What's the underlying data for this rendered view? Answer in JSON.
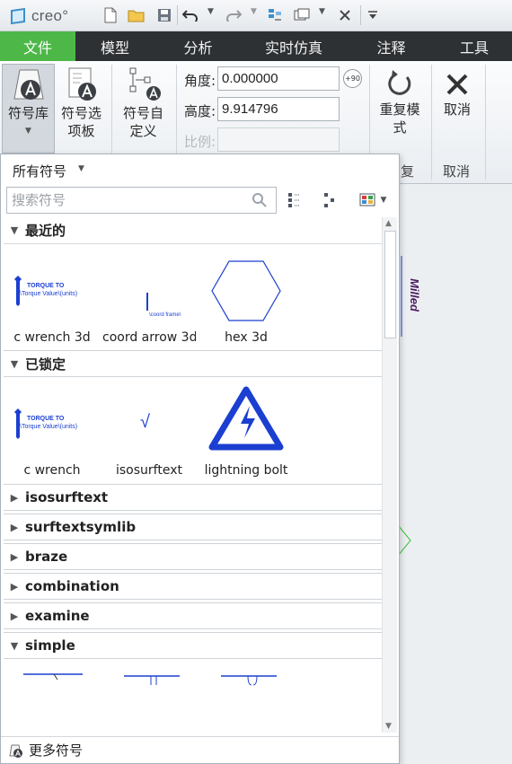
{
  "app": {
    "logo_text": "creo°"
  },
  "quick_access": {
    "icons": [
      "new-file-icon",
      "open-folder-icon",
      "save-icon",
      "undo-icon",
      "redo-icon",
      "regenerate-icon",
      "window-icon",
      "close-window-icon",
      "customize-icon"
    ]
  },
  "tabs": [
    {
      "label": "文件",
      "active": true
    },
    {
      "label": "模型"
    },
    {
      "label": "分析"
    },
    {
      "label": "实时仿真"
    },
    {
      "label": "注释"
    },
    {
      "label": "工具"
    }
  ],
  "ribbon": {
    "symbol_library": "符号库",
    "symbol_palette_l1": "符号选",
    "symbol_palette_l2": "项板",
    "custom_symbol_l1": "符号自",
    "custom_symbol_l2": "定义",
    "angle_label": "角度:",
    "angle_value": "0.000000",
    "height_label": "高度:",
    "height_value": "9.914796",
    "scale_label": "比例:",
    "scale_value": "",
    "rotate_badge": "+90",
    "repeat_l1": "重复模",
    "repeat_l2": "式",
    "repeat_group": "复",
    "cancel_label": "取消",
    "cancel_group": "取消"
  },
  "palette": {
    "filter_label": "所有符号",
    "search_placeholder": "搜索符号",
    "sections": {
      "recent": {
        "label": "最近的",
        "items": [
          "c wrench 3d",
          "coord arrow 3d",
          "hex 3d"
        ]
      },
      "locked": {
        "label": "已锁定",
        "items": [
          "c wrench",
          "isosurftext",
          "lightning bolt"
        ]
      },
      "collapsed": [
        "isosurftext",
        "surftextsymlib",
        "braze",
        "combination",
        "examine"
      ],
      "simple": {
        "label": "simple"
      }
    },
    "more_symbols": "更多符号",
    "torque_line1": "TORQUE TO",
    "torque_line2": "\\Torque Value\\(units)",
    "coord_text": "\\coord frame\\",
    "checkmark": "√"
  },
  "canvas": {
    "milled_text": "Milled"
  },
  "colors": {
    "accent_green": "#4db848",
    "tab_bar": "#2e3134",
    "symbol_blue": "#1b3fd1"
  }
}
